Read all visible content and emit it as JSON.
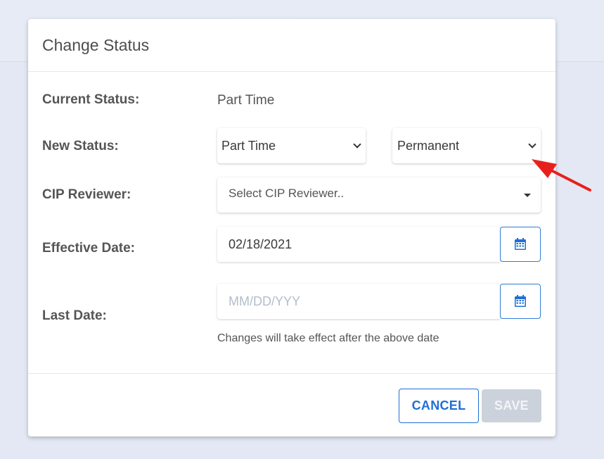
{
  "dialog": {
    "title": "Change Status",
    "current_status": {
      "label": "Current Status:",
      "value": "Part Time"
    },
    "new_status": {
      "label": "New Status:",
      "selected_from": "Part Time",
      "selected_to": "Permanent"
    },
    "cip_reviewer": {
      "label": "CIP Reviewer:",
      "placeholder": "Select CIP Reviewer.."
    },
    "effective_date": {
      "label": "Effective Date:",
      "value": "02/18/2021"
    },
    "last_date": {
      "label": "Last Date:",
      "placeholder": "MM/DD/YYY",
      "hint": "Changes will take effect after the above date"
    },
    "buttons": {
      "cancel": "CANCEL",
      "save": "SAVE"
    }
  },
  "icons": {
    "calendar": "calendar-icon",
    "chevron": "chevron-down-icon",
    "caret": "caret-down-icon",
    "annotation": "red-arrow-annotation"
  },
  "colors": {
    "accent": "#1f6fd6",
    "annotation": "#e8201c",
    "disabled_button": "#ccd2dc",
    "backdrop": "#e3e8f4"
  }
}
